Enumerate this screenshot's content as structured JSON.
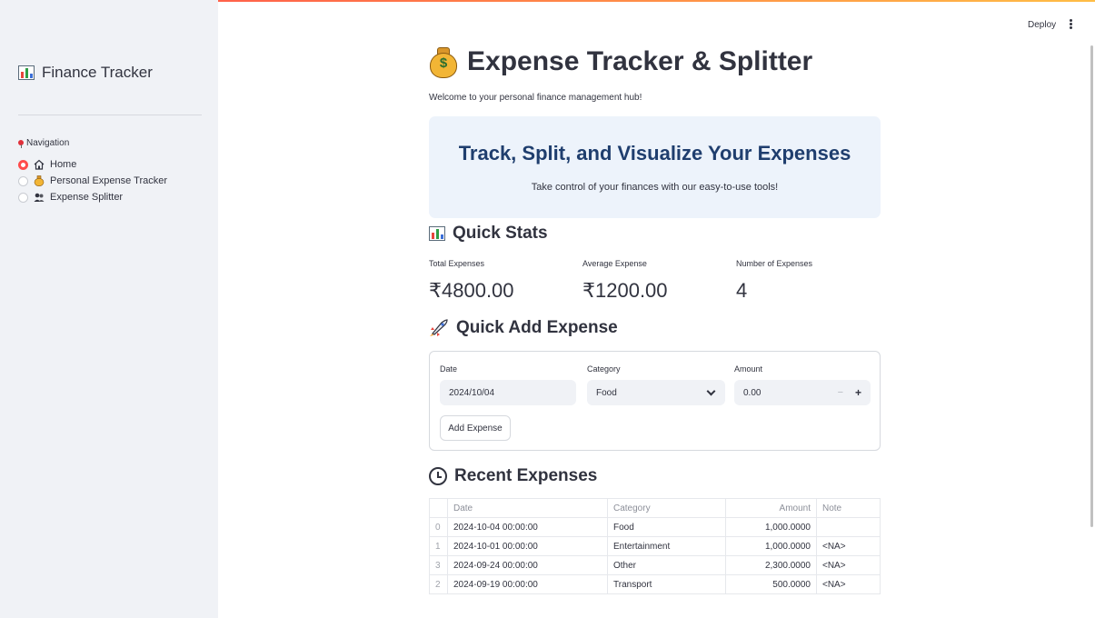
{
  "sidebar": {
    "title": "Finance Tracker",
    "nav_label": "Navigation",
    "items": [
      {
        "label": "Home",
        "icon": "house-icon",
        "selected": true
      },
      {
        "label": "Personal Expense Tracker",
        "icon": "money-bag-icon",
        "selected": false
      },
      {
        "label": "Expense Splitter",
        "icon": "people-icon",
        "selected": false
      }
    ]
  },
  "header": {
    "deploy_label": "Deploy"
  },
  "main": {
    "title": "Expense Tracker & Splitter",
    "welcome": "Welcome to your personal finance management hub!",
    "hero": {
      "title": "Track, Split, and Visualize Your Expenses",
      "subtitle": "Take control of your finances with our easy-to-use tools!"
    },
    "quick_stats": {
      "heading": "Quick Stats",
      "stats": [
        {
          "label": "Total Expenses",
          "value": "₹4800.00"
        },
        {
          "label": "Average Expense",
          "value": "₹1200.00"
        },
        {
          "label": "Number of Expenses",
          "value": "4"
        }
      ]
    },
    "quick_add": {
      "heading": "Quick Add Expense",
      "date_label": "Date",
      "date_value": "2024/10/04",
      "category_label": "Category",
      "category_value": "Food",
      "amount_label": "Amount",
      "amount_value": "0.00",
      "stepper_minus": "−",
      "stepper_plus": "+",
      "button_label": "Add Expense"
    },
    "recent": {
      "heading": "Recent Expenses",
      "columns": [
        "",
        "Date",
        "Category",
        "Amount",
        "Note"
      ],
      "rows": [
        {
          "index": "0",
          "date": "2024-10-04 00:00:00",
          "category": "Food",
          "amount": "1,000.0000",
          "note": ""
        },
        {
          "index": "1",
          "date": "2024-10-01 00:00:00",
          "category": "Entertainment",
          "amount": "1,000.0000",
          "note": "<NA>"
        },
        {
          "index": "3",
          "date": "2024-09-24 00:00:00",
          "category": "Other",
          "amount": "2,300.0000",
          "note": "<NA>"
        },
        {
          "index": "2",
          "date": "2024-09-19 00:00:00",
          "category": "Transport",
          "amount": "500.0000",
          "note": "<NA>"
        }
      ]
    }
  },
  "colors": {
    "accent": "#ff4b4b",
    "hero_bg": "#edf3fb",
    "hero_title": "#1f3e6e",
    "sidebar_bg": "#f0f2f6"
  }
}
